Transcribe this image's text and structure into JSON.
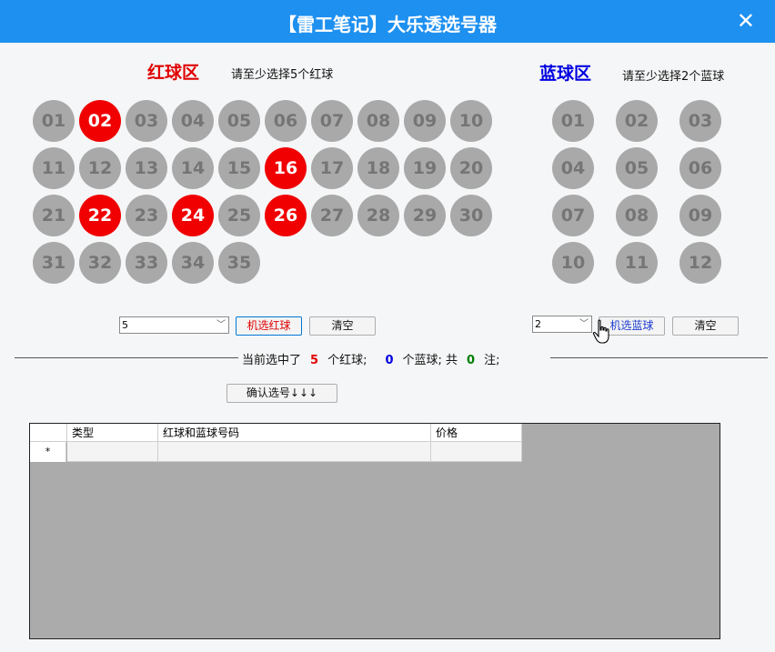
{
  "window": {
    "title": "【雷工笔记】大乐透选号器",
    "close_label": "✕"
  },
  "red_zone": {
    "title": "红球区",
    "hint": "请至少选择5个红球",
    "title_color": "#e00000",
    "balls": [
      {
        "label": "01",
        "selected": false
      },
      {
        "label": "02",
        "selected": true
      },
      {
        "label": "03",
        "selected": false
      },
      {
        "label": "04",
        "selected": false
      },
      {
        "label": "05",
        "selected": false
      },
      {
        "label": "06",
        "selected": false
      },
      {
        "label": "07",
        "selected": false
      },
      {
        "label": "08",
        "selected": false
      },
      {
        "label": "09",
        "selected": false
      },
      {
        "label": "10",
        "selected": false
      },
      {
        "label": "11",
        "selected": false
      },
      {
        "label": "12",
        "selected": false
      },
      {
        "label": "13",
        "selected": false
      },
      {
        "label": "14",
        "selected": false
      },
      {
        "label": "15",
        "selected": false
      },
      {
        "label": "16",
        "selected": true
      },
      {
        "label": "17",
        "selected": false
      },
      {
        "label": "18",
        "selected": false
      },
      {
        "label": "19",
        "selected": false
      },
      {
        "label": "20",
        "selected": false
      },
      {
        "label": "21",
        "selected": false
      },
      {
        "label": "22",
        "selected": true
      },
      {
        "label": "23",
        "selected": false
      },
      {
        "label": "24",
        "selected": true
      },
      {
        "label": "25",
        "selected": false
      },
      {
        "label": "26",
        "selected": true
      },
      {
        "label": "27",
        "selected": false
      },
      {
        "label": "28",
        "selected": false
      },
      {
        "label": "29",
        "selected": false
      },
      {
        "label": "30",
        "selected": false
      },
      {
        "label": "31",
        "selected": false
      },
      {
        "label": "32",
        "selected": false
      },
      {
        "label": "33",
        "selected": false
      },
      {
        "label": "34",
        "selected": false
      },
      {
        "label": "35",
        "selected": false
      }
    ],
    "count_select": "5",
    "random_button": "机选红球",
    "clear_button": "清空"
  },
  "blue_zone": {
    "title": "蓝球区",
    "hint": "请至少选择2个蓝球",
    "title_color": "#0000e0",
    "balls": [
      {
        "label": "01",
        "selected": false
      },
      {
        "label": "02",
        "selected": false
      },
      {
        "label": "03",
        "selected": false
      },
      {
        "label": "04",
        "selected": false
      },
      {
        "label": "05",
        "selected": false
      },
      {
        "label": "06",
        "selected": false
      },
      {
        "label": "07",
        "selected": false
      },
      {
        "label": "08",
        "selected": false
      },
      {
        "label": "09",
        "selected": false
      },
      {
        "label": "10",
        "selected": false
      },
      {
        "label": "11",
        "selected": false
      },
      {
        "label": "12",
        "selected": false
      }
    ],
    "count_select": "2",
    "random_button": "机选蓝球",
    "clear_button": "清空"
  },
  "summary": {
    "prefix": "当前选中了",
    "red_count": "5",
    "red_suffix": "个红球;",
    "blue_count": "0",
    "blue_suffix": "个蓝球; 共",
    "total": "0",
    "total_suffix": "注;"
  },
  "confirm_button": "确认选号↓↓↓",
  "grid": {
    "columns": [
      "类型",
      "红球和蓝球号码",
      "价格"
    ],
    "new_row_marker": "*"
  }
}
